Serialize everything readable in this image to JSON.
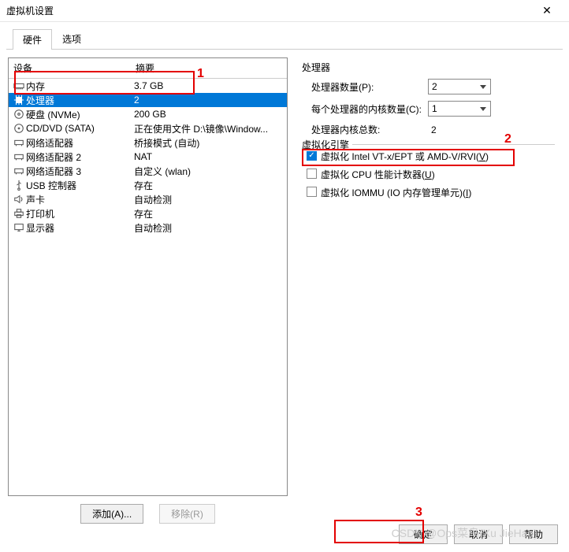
{
  "title": "虚拟机设置",
  "tabs": {
    "hardware": "硬件",
    "options": "选项"
  },
  "list_header": {
    "device": "设备",
    "summary": "摘要"
  },
  "devices": [
    {
      "icon": "memory",
      "name": "内存",
      "summary": "3.7 GB"
    },
    {
      "icon": "cpu",
      "name": "处理器",
      "summary": "2",
      "selected": true
    },
    {
      "icon": "disk",
      "name": "硬盘 (NVMe)",
      "summary": "200 GB"
    },
    {
      "icon": "cd",
      "name": "CD/DVD (SATA)",
      "summary": "正在使用文件 D:\\镜像\\Window..."
    },
    {
      "icon": "net",
      "name": "网络适配器",
      "summary": "桥接模式 (自动)"
    },
    {
      "icon": "net",
      "name": "网络适配器 2",
      "summary": "NAT"
    },
    {
      "icon": "net",
      "name": "网络适配器 3",
      "summary": "自定义 (wlan)"
    },
    {
      "icon": "usb",
      "name": "USB 控制器",
      "summary": "存在"
    },
    {
      "icon": "sound",
      "name": "声卡",
      "summary": "自动检测"
    },
    {
      "icon": "printer",
      "name": "打印机",
      "summary": "存在"
    },
    {
      "icon": "display",
      "name": "显示器",
      "summary": "自动检测"
    }
  ],
  "left_buttons": {
    "add": "添加(A)...",
    "remove": "移除(R)"
  },
  "right": {
    "group_processor": "处理器",
    "num_processors_label": "处理器数量(P):",
    "num_processors_value": "2",
    "cores_label": "每个处理器的内核数量(C):",
    "cores_value": "1",
    "total_label": "处理器内核总数:",
    "total_value": "2",
    "group_virt": "虚拟化引擎",
    "virt_vtx": "虚拟化 Intel VT-x/EPT 或 AMD-V/RVI(V)",
    "virt_vtx_accel_u": "V",
    "virt_perf": "虚拟化 CPU 性能计数器(U)",
    "virt_perf_accel_u": "U",
    "virt_iommu": "虚拟化 IOMMU (IO 内存管理单元)(I)",
    "virt_iommu_accel_u": "I"
  },
  "footer": {
    "ok": "确定",
    "cancel": "取消",
    "help": "帮助"
  },
  "annotations": {
    "a1": "1",
    "a2": "2",
    "a3": "3"
  },
  "watermark": "CSDN @Ops菜鸟(Xu JieHao)"
}
